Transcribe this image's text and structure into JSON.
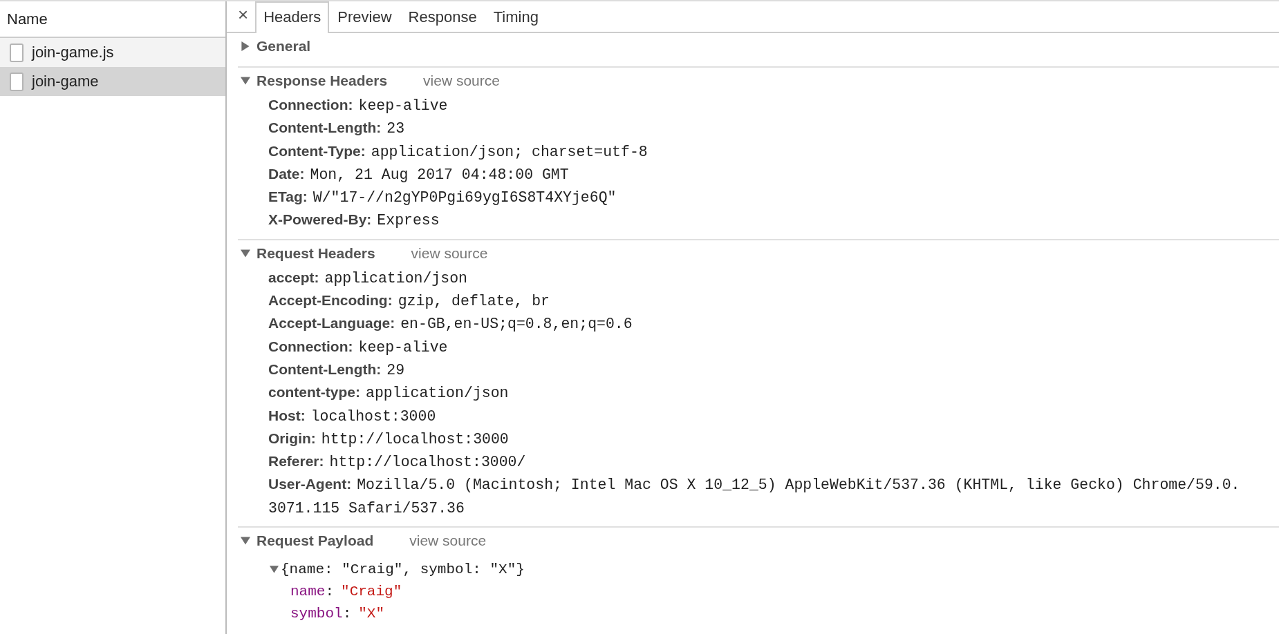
{
  "sidebar": {
    "header": "Name",
    "items": [
      {
        "label": "join-game.js",
        "selected": false
      },
      {
        "label": "join-game",
        "selected": true
      }
    ]
  },
  "close": "×",
  "tabs": [
    {
      "label": "Headers",
      "selected": true
    },
    {
      "label": "Preview",
      "selected": false
    },
    {
      "label": "Response",
      "selected": false
    },
    {
      "label": "Timing",
      "selected": false
    }
  ],
  "sections": [
    {
      "title": "General",
      "expanded": false
    },
    {
      "kind": "headers",
      "title": "Response Headers",
      "expanded": true,
      "link": "view source",
      "rows": [
        {
          "key": "Connection:",
          "value": "keep-alive"
        },
        {
          "key": "Content-Length:",
          "value": "23"
        },
        {
          "key": "Content-Type:",
          "value": "application/json; charset=utf-8"
        },
        {
          "key": "Date:",
          "value": "Mon, 21 Aug 2017 04:48:00 GMT"
        },
        {
          "key": "ETag:",
          "value": "W/\"17-//n2gYP0Pgi69ygI6S8T4XYje6Q\""
        },
        {
          "key": "X-Powered-By:",
          "value": "Express"
        }
      ]
    },
    {
      "kind": "headers",
      "title": "Request Headers",
      "expanded": true,
      "link": "view source",
      "rows": [
        {
          "key": "accept:",
          "value": "application/json"
        },
        {
          "key": "Accept-Encoding:",
          "value": "gzip, deflate, br"
        },
        {
          "key": "Accept-Language:",
          "value": "en-GB,en-US;q=0.8,en;q=0.6"
        },
        {
          "key": "Connection:",
          "value": "keep-alive"
        },
        {
          "key": "Content-Length:",
          "value": "29"
        },
        {
          "key": "content-type:",
          "value": "application/json"
        },
        {
          "key": "Host:",
          "value": "localhost:3000"
        },
        {
          "key": "Origin:",
          "value": "http://localhost:3000"
        },
        {
          "key": "Referer:",
          "value": "http://localhost:3000/"
        },
        {
          "key": "User-Agent:",
          "value": "Mozilla/5.0 (Macintosh; Intel Mac OS X 10_12_5) AppleWebKit/537.36 (KHTML, like Gecko) Chrome/59.0.",
          "value_cont": "3071.115 Safari/537.36"
        }
      ]
    },
    {
      "kind": "payload",
      "title": "Request Payload",
      "expanded": true,
      "link": "view source",
      "summary": "{name: \"Craig\", symbol: \"X\"}",
      "summary_expanded": true,
      "props": [
        {
          "key": "name",
          "separator": ":",
          "value": "\"Craig\""
        },
        {
          "key": "symbol",
          "separator": ":",
          "value": "\"X\""
        }
      ]
    }
  ]
}
